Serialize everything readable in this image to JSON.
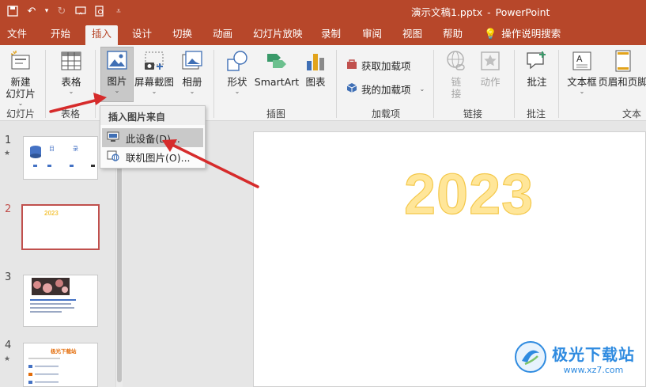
{
  "window": {
    "title": "演示文稿1.pptx",
    "app": "PowerPoint",
    "separator": "-"
  },
  "tabs": [
    {
      "label": "文件"
    },
    {
      "label": "开始"
    },
    {
      "label": "插入"
    },
    {
      "label": "设计"
    },
    {
      "label": "切换"
    },
    {
      "label": "动画"
    },
    {
      "label": "幻灯片放映"
    },
    {
      "label": "录制"
    },
    {
      "label": "审阅"
    },
    {
      "label": "视图"
    },
    {
      "label": "帮助"
    },
    {
      "label": "操作说明搜索"
    }
  ],
  "ribbon": {
    "new_slide": {
      "line1": "新建",
      "line2": "幻灯片"
    },
    "table": "表格",
    "pictures": "图片",
    "screenshot": "屏幕截图",
    "album": "相册",
    "shapes": "形状",
    "smartart": "SmartArt",
    "chart": "图表",
    "get_addins": "获取加载项",
    "my_addins": "我的加载项",
    "link": "链接",
    "action": "动作",
    "comment": "批注",
    "textbox": "文本框",
    "header_footer": "页眉和页脚",
    "groups": {
      "slides": "幻灯片",
      "tables": "表格",
      "illustrations": "插图",
      "addins": "加载项",
      "links": "链接",
      "comments": "批注",
      "text": "文本"
    }
  },
  "picture_menu": {
    "header": "插入图片来自",
    "items": [
      {
        "label": "此设备(D)..."
      },
      {
        "label": "联机图片(O)..."
      }
    ]
  },
  "slides": [
    {
      "number": "1",
      "text_a": "目",
      "text_b": "录"
    },
    {
      "number": "2",
      "text": "2023"
    },
    {
      "number": "3"
    },
    {
      "number": "4",
      "text": "极光下载站"
    }
  ],
  "current_slide": {
    "title": "2023"
  },
  "watermark": {
    "name": "极光下载站",
    "url": "www.xz7.com"
  },
  "colors": {
    "accent": "#b7472a",
    "ribbon_bg": "#f3f3f3",
    "title_fill": "#ffe699",
    "arrow": "#d62b2b"
  }
}
